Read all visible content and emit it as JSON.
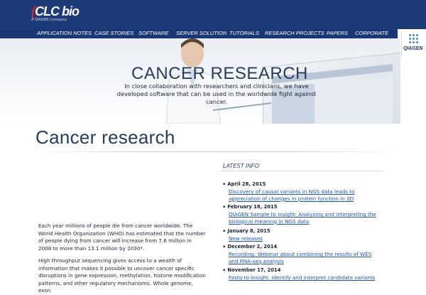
{
  "brand": {
    "name": "CLC bio",
    "tagline": "A QIAGEN Company",
    "partner_logo": "QIAGEN"
  },
  "nav": {
    "items": [
      "APPLICATION NOTES",
      "CASE STORIES",
      "SOFTWARE",
      "SERVER SOLUTION",
      "TUTORIALS",
      "RESEARCH PROJECTS",
      "PAPERS",
      "CORPORATE"
    ]
  },
  "hero": {
    "title": "CANCER RESEARCH",
    "subtitle": "In close collaboration with researchers and clinicians, we have developed software that can be used in the worldwide fight against cancer."
  },
  "page": {
    "title": "Cancer research"
  },
  "latest": {
    "heading": "LATEST INFO",
    "items": [
      {
        "date": "April 28, 2015",
        "text": "Discovery of causal variants in NGS data leads to appreciation of changes in protein function in 3D"
      },
      {
        "date": "February 18, 2015",
        "text": "QIAGEN Sample to Insight: Analyzing and interpreting the biological meaning in NGS data"
      },
      {
        "date": "January 8, 2015",
        "text": "New releases"
      },
      {
        "date": "December 2, 2014",
        "text": "Recording: Webinar about combining the results of WES and RNA-seq analysis"
      },
      {
        "date": "November 17, 2014",
        "text": "Fastq-to-insight: Identify and interpret candidate variants"
      }
    ]
  },
  "body": {
    "p1": "Each year millions of people die from cancer worldwide. The World Health Organization (WHO) has estimated that the number of people dying from cancer will increase from 7.6 million in 2008 to more than 13.1 million by 2030*.",
    "p2": "High throughput sequencing gives access to a wealth of information that makes it possible to uncover cancer specific disruptions in gene expression, methylation, histone modification patterns, and other regulatory mechanisms. Whole genome, exon"
  },
  "colors": {
    "header_bg": "#1d3a78",
    "nav_bg": "#1a3775",
    "link": "#1f52b3",
    "title": "#2a3b5c"
  }
}
